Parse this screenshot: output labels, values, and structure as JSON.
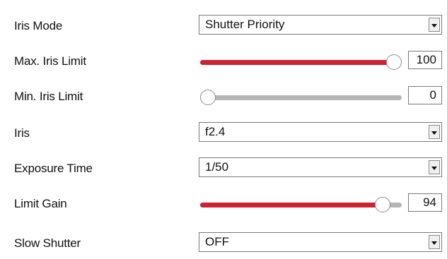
{
  "rows": {
    "iris_mode": {
      "label": "Iris Mode",
      "value": "Shutter Priority"
    },
    "max_iris_limit": {
      "label": "Max. Iris Limit",
      "value": "100",
      "level": 1.0
    },
    "min_iris_limit": {
      "label": "Min. Iris Limit",
      "value": "0",
      "level": 0.0
    },
    "iris": {
      "label": "Iris",
      "value": "f2.4"
    },
    "exposure_time": {
      "label": "Exposure Time",
      "value": "1/50"
    },
    "limit_gain": {
      "label": "Limit Gain",
      "value": "94",
      "level": 0.94
    },
    "slow_shutter": {
      "label": "Slow Shutter",
      "value": "OFF"
    }
  },
  "colors": {
    "slider_fill": "#cc2233",
    "slider_track": "#b5b5b5"
  }
}
